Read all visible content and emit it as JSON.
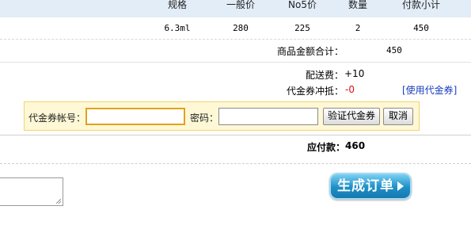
{
  "table": {
    "headers": [
      "规格",
      "一般价",
      "No5价",
      "数量",
      "付款小计"
    ],
    "row": [
      "6.3ml",
      "280",
      "225",
      "2",
      "450"
    ]
  },
  "totals": {
    "goods_total_label": "商品金额合计：",
    "goods_total_value": "450",
    "shipping_label": "配送费：",
    "shipping_value": "+10",
    "coupon_offset_label": "代金券冲抵：",
    "coupon_offset_value": "-0",
    "use_coupon_link": "[使用代金券]",
    "payable_label": "应付款：",
    "payable_value": "460"
  },
  "coupon_form": {
    "account_label": "代金券帐号：",
    "account_value": "",
    "password_label": "密码：",
    "password_value": "",
    "verify_button": "验证代金券",
    "cancel_button": "取消"
  },
  "order": {
    "remark_value": "",
    "submit_button": "生成订单"
  }
}
